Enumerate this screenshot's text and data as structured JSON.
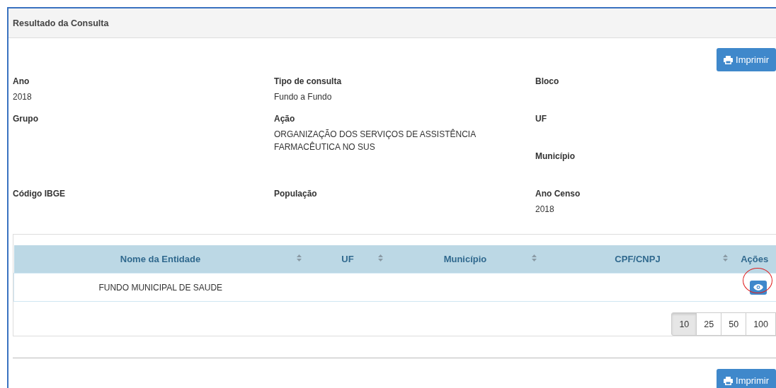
{
  "panel": {
    "title": "Resultado da Consulta"
  },
  "print_button_top": {
    "label": "Imprimir"
  },
  "info_rows": [
    {
      "cells": [
        {
          "fields": [
            {
              "label": "Ano",
              "value": "2018"
            }
          ]
        },
        {
          "fields": [
            {
              "label": "Tipo de consulta",
              "value": "Fundo a Fundo"
            }
          ]
        },
        {
          "fields": [
            {
              "label": "Bloco"
            }
          ]
        }
      ]
    },
    {
      "cells": [
        {
          "fields": [
            {
              "label": "Grupo"
            }
          ]
        },
        {
          "fields": [
            {
              "label": "Ação",
              "value": "ORGANIZAÇÃO DOS SERVIÇOS DE ASSISTÊNCIA FARMACÊUTICA NO SUS"
            }
          ]
        },
        {
          "fields": [
            {
              "label": "UF"
            },
            {
              "label": "Município"
            }
          ]
        }
      ]
    },
    {
      "cells": [
        {
          "fields": [
            {
              "label": "Código IBGE"
            }
          ]
        },
        {
          "fields": [
            {
              "label": "População"
            }
          ]
        },
        {
          "fields": [
            {
              "label": "Ano Censo",
              "value": "2018"
            }
          ]
        }
      ]
    }
  ],
  "table": {
    "columns": [
      {
        "label": "Nome da Entidade",
        "sortable": true
      },
      {
        "label": "UF",
        "sortable": true
      },
      {
        "label": "Município",
        "sortable": true
      },
      {
        "label": "CPF/CNPJ",
        "sortable": true
      },
      {
        "label": "Ações",
        "sortable": false
      }
    ],
    "rows": [
      {
        "cells": [
          "FUNDO MUNICIPAL DE SAUDE",
          "",
          "",
          "",
          ""
        ],
        "highlighted": true
      }
    ]
  },
  "page_sizes": [
    {
      "label": "10",
      "selected": true
    },
    {
      "label": "25",
      "selected": false
    },
    {
      "label": "50",
      "selected": false
    },
    {
      "label": "100",
      "selected": false
    }
  ],
  "print_button_bottom": {
    "label": "Imprimir"
  }
}
